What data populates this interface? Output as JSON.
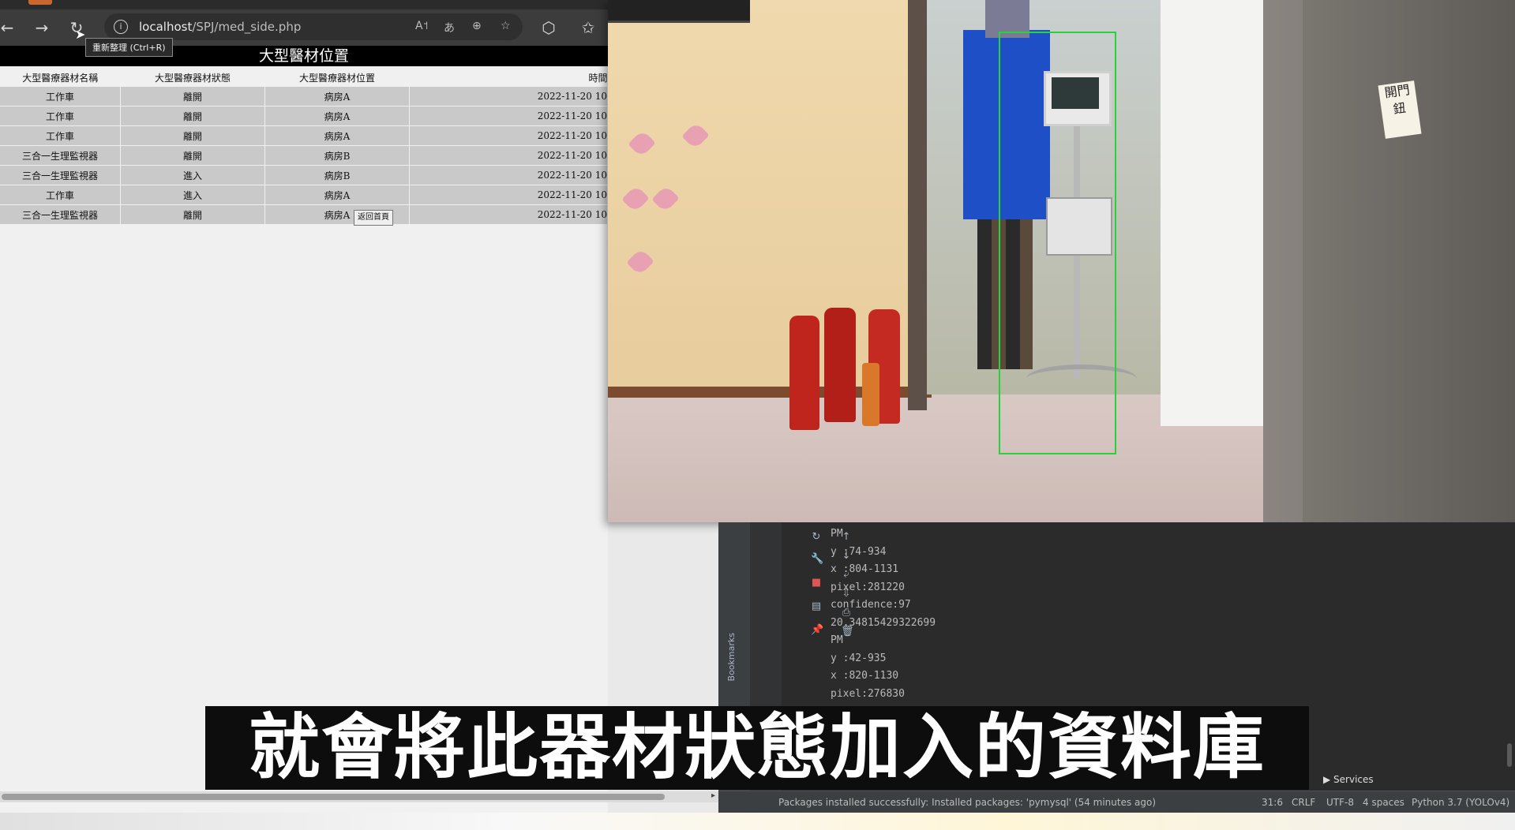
{
  "browser": {
    "tooltip": "重新整理 (Ctrl+R)",
    "url_host": "localhost",
    "url_path": "/SPJ/med_side.php",
    "icons": [
      "back-icon",
      "forward-icon",
      "refresh-icon",
      "info-icon",
      "read-aloud-icon",
      "translate-icon",
      "zoom-icon",
      "favorite-icon",
      "extensions-icon",
      "favorites-bar-icon"
    ]
  },
  "page": {
    "title": "大型醫材位置",
    "columns": [
      "大型醫療器材名稱",
      "大型醫療器材狀態",
      "大型醫療器材位置",
      "時間"
    ],
    "rows": [
      [
        "工作車",
        "離開",
        "病房A",
        "2022-11-20 10"
      ],
      [
        "工作車",
        "離開",
        "病房A",
        "2022-11-20 10"
      ],
      [
        "工作車",
        "離開",
        "病房A",
        "2022-11-20 10"
      ],
      [
        "三合一生理監視器",
        "離開",
        "病房B",
        "2022-11-20 10"
      ],
      [
        "三合一生理監視器",
        "進入",
        "病房B",
        "2022-11-20 10"
      ],
      [
        "工作車",
        "進入",
        "病房A",
        "2022-11-20 10"
      ],
      [
        "三合一生理監視器",
        "離開",
        "病房A",
        "2022-11-20 10"
      ]
    ],
    "back_button": "返回首頁"
  },
  "camera": {
    "sign_text": "開門鈕",
    "box_color": "#27d23a"
  },
  "console": {
    "lines": [
      "PM",
      "y :74-934",
      "x :804-1131",
      "pixel:281220",
      "confidence:97",
      "20.34815429322699",
      "PM",
      "y :42-935",
      "x :820-1130",
      "pixel:276830"
    ]
  },
  "ide": {
    "bookmarks_tab": "Bookmarks",
    "services_tab": "Services",
    "status_message": "Packages installed successfully: Installed packages: 'pymysql' (54 minutes ago)",
    "cursor_pos": "31:6",
    "line_sep": "CRLF",
    "encoding": "UTF-8",
    "indent": "4 spaces",
    "interpreter": "Python 3.7 (YOLOv4)"
  },
  "caption": "就會將此器材狀態加入的資料庫"
}
